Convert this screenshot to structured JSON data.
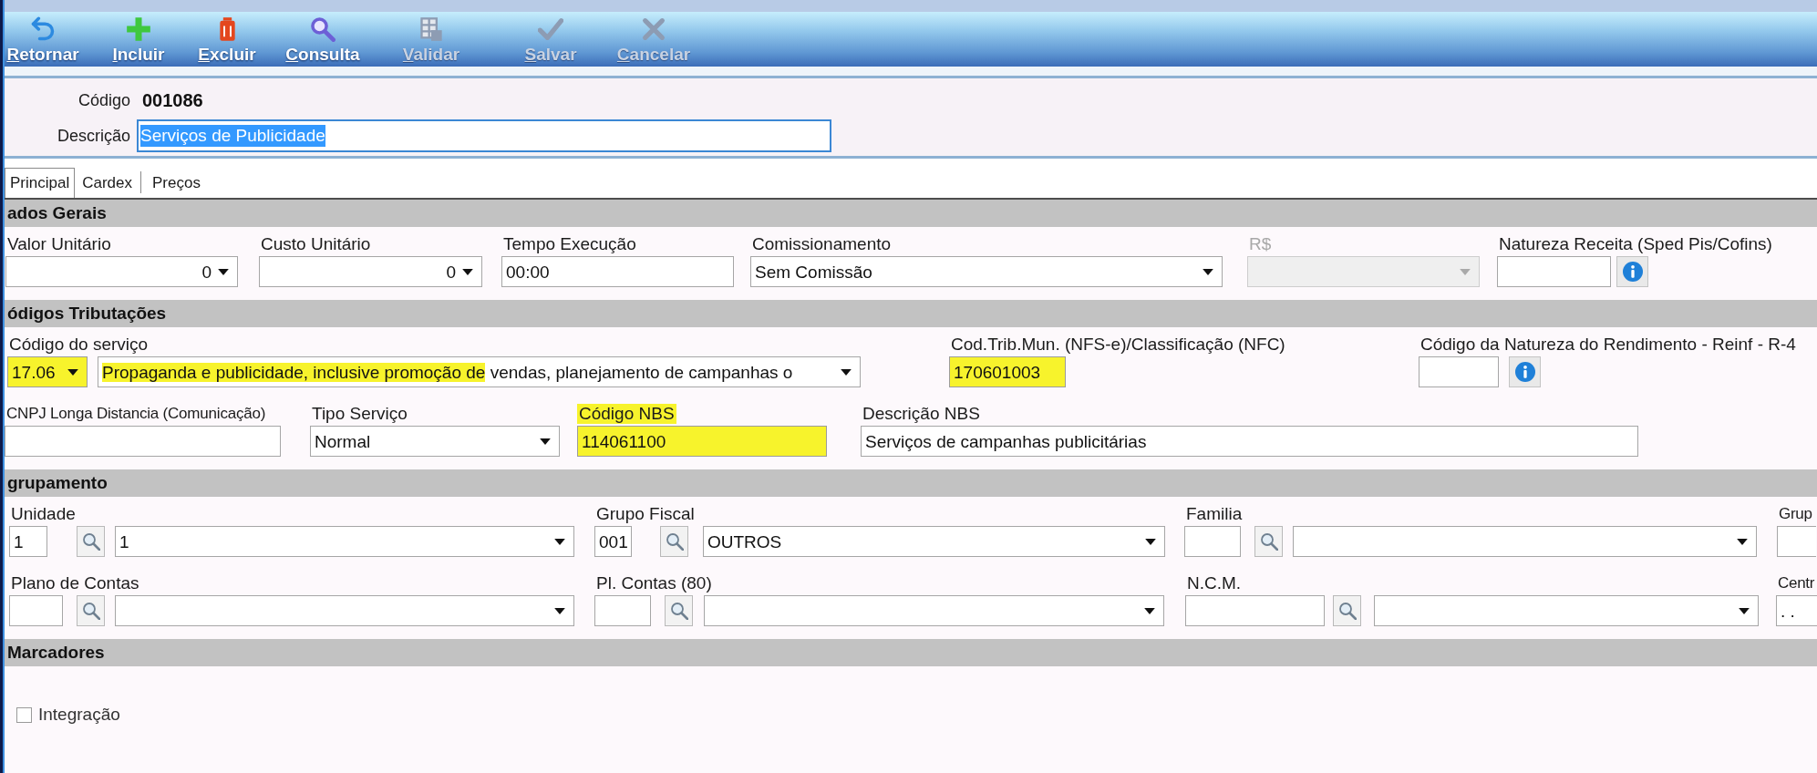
{
  "toolbar": [
    {
      "label": "Retornar",
      "disabled": false
    },
    {
      "label": "Incluir",
      "disabled": false
    },
    {
      "label": "Excluir",
      "disabled": false
    },
    {
      "label": "Consulta",
      "disabled": false
    },
    {
      "label": "Validar",
      "disabled": true
    },
    {
      "label": "Salvar",
      "disabled": true
    },
    {
      "label": "Cancelar",
      "disabled": true
    }
  ],
  "header": {
    "code_label": "Código",
    "code_value": "001086",
    "description_label": "Descrição",
    "description_value": "Serviços de Publicidade",
    "description_selected": true,
    "description_focused": true
  },
  "tabs": [
    {
      "label": "Principal",
      "selected": true
    },
    {
      "label": "Cardex",
      "selected": false
    },
    {
      "label": "Preços",
      "selected": false
    }
  ],
  "sections": [
    {
      "title": "ados Gerais",
      "field_rows": [
        {
          "fields": [
            {
              "kind": "number_combo",
              "label": "Valor Unitário",
              "value": "0",
              "label_highlighted": false,
              "value_highlighted": false,
              "disabled": false
            },
            {
              "kind": "number_combo",
              "label": "Custo Unitário",
              "value": "0",
              "label_highlighted": false,
              "value_highlighted": false,
              "disabled": false
            },
            {
              "kind": "input",
              "label": "Tempo Execução",
              "value": "00:00",
              "label_highlighted": false,
              "value_highlighted": false,
              "disabled": false
            },
            {
              "kind": "combo",
              "label": "Comissionamento",
              "value": "Sem Comissão",
              "label_highlighted": false,
              "value_highlighted": false,
              "disabled": false
            },
            {
              "kind": "combo",
              "label": "R$",
              "label_highlighted": false,
              "value_highlighted": false,
              "disabled": true
            },
            {
              "kind": "info_input",
              "label": "Natureza Receita (Sped Pis/Cofins)",
              "label_highlighted": false,
              "value_highlighted": false,
              "disabled": false
            }
          ]
        }
      ]
    },
    {
      "title": "ódigos Tributações",
      "field_rows": [
        {
          "fields": [
            {
              "kind": "combo",
              "label": "Código do serviço",
              "value": "17.06",
              "label_highlighted": false,
              "value_highlighted": true,
              "disabled": false
            },
            {
              "kind": "combo",
              "value_segments": [
                {
                  "text": "Propaganda e publicidade, inclusive promoção de",
                  "highlighted": true
                },
                {
                  "text": "vendas, planejamento de campanhas o",
                  "highlighted": false
                }
              ],
              "disabled": false
            },
            {
              "kind": "input",
              "label": "Cod.Trib.Mun. (NFS-e)/Classificação (NFC)",
              "value": "170601003",
              "label_highlighted": false,
              "value_highlighted": true,
              "disabled": false
            },
            {
              "kind": "info_input",
              "label": "Código da Natureza do Rendimento - Reinf - R-4",
              "label_highlighted": false,
              "value_highlighted": false,
              "disabled": false
            }
          ]
        },
        {
          "fields": [
            {
              "kind": "input",
              "label": "CNPJ Longa Distancia (Comunicação)",
              "label_highlighted": false,
              "value_highlighted": false,
              "disabled": false
            },
            {
              "kind": "combo",
              "label": "Tipo Serviço",
              "value": "Normal",
              "label_highlighted": false,
              "value_highlighted": false,
              "disabled": false
            },
            {
              "kind": "input",
              "label": "Código NBS",
              "value": "114061100",
              "label_highlighted": true,
              "value_highlighted": true,
              "disabled": false
            },
            {
              "kind": "input",
              "label": "Descrição NBS",
              "value": "Serviços de campanhas publicitárias",
              "label_highlighted": false,
              "value_highlighted": false,
              "disabled": false
            }
          ]
        }
      ]
    },
    {
      "title": "grupamento",
      "field_rows": [
        {
          "fields": [
            {
              "kind": "lookup",
              "label": "Unidade",
              "code": "1",
              "value": "1",
              "label_highlighted": false,
              "value_highlighted": false,
              "disabled": false
            },
            {
              "kind": "lookup",
              "label": "Grupo Fiscal",
              "code": "001",
              "value": "OUTROS",
              "label_highlighted": false,
              "value_highlighted": false,
              "disabled": false
            },
            {
              "kind": "lookup",
              "label": "Familia",
              "label_highlighted": false,
              "value_highlighted": false,
              "disabled": false
            },
            {
              "kind": "input",
              "label": "Grup",
              "label_highlighted": false,
              "value_highlighted": false,
              "disabled": false
            }
          ]
        },
        {
          "fields": [
            {
              "kind": "lookup",
              "label": "Plano de Contas",
              "label_highlighted": false,
              "value_highlighted": false,
              "disabled": false
            },
            {
              "kind": "lookup",
              "label": "Pl. Contas (80)",
              "label_highlighted": false,
              "value_highlighted": false,
              "disabled": false
            },
            {
              "kind": "lookup",
              "label": "N.C.M.",
              "label_highlighted": false,
              "value_highlighted": false,
              "disabled": false
            },
            {
              "kind": "input",
              "label": "Centr",
              "value": ". .",
              "label_highlighted": false,
              "value_highlighted": false,
              "disabled": false
            }
          ]
        }
      ]
    },
    {
      "title": "Marcadores",
      "checkboxes": [
        {
          "label": "Integração",
          "checked": false
        }
      ]
    }
  ]
}
